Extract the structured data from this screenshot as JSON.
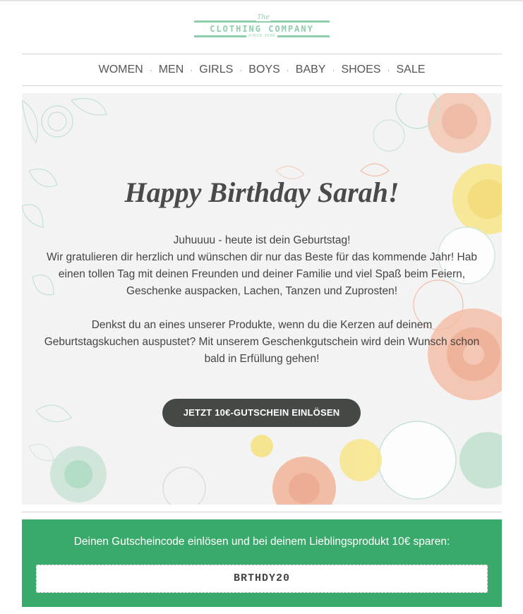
{
  "brand": {
    "the": "The",
    "name": "CLOTHING COMPANY",
    "since": "SINCE 2008",
    "color": "#8ccfaa"
  },
  "nav": {
    "items": [
      "WOMEN",
      "MEN",
      "GIRLS",
      "BOYS",
      "BABY",
      "SHOES",
      "SALE"
    ],
    "separator": "·"
  },
  "hero": {
    "title": "Happy Birthday Sarah!",
    "paragraph1_lines": [
      "Juhuuuu - heute ist dein Geburtstag!",
      "Wir gratulieren dir herzlich und wünschen dir nur das Beste für das kommende Jahr! Hab",
      "einen tollen Tag mit deinen Freunden und deiner Familie und viel Spaß beim Feiern,",
      "Geschenke auspacken, Lachen, Tanzen und Zuprosten!"
    ],
    "paragraph2_lines": [
      "Denkst du an eines unserer Produkte, wenn du die Kerzen auf deinem",
      "Geburtstagskuchen auspustet? Mit unserem Geschenkgutschein wird dein Wunsch schon",
      "bald in Erfüllung gehen!"
    ],
    "cta_label": "JETZT 10€-GUTSCHEIN EINLÖSEN",
    "background": "#f3f3f3"
  },
  "voucher": {
    "text": "Deinen Gutscheincode einlösen und bei deinem Lieblingsprodukt 10€ sparen:",
    "code": "BRTHDY20",
    "background": "#3aaa6c"
  },
  "colors": {
    "button": "#444946",
    "floral_peach": "#f2b49a",
    "floral_yellow": "#f6e27c",
    "floral_mint": "#a9d8c0"
  }
}
